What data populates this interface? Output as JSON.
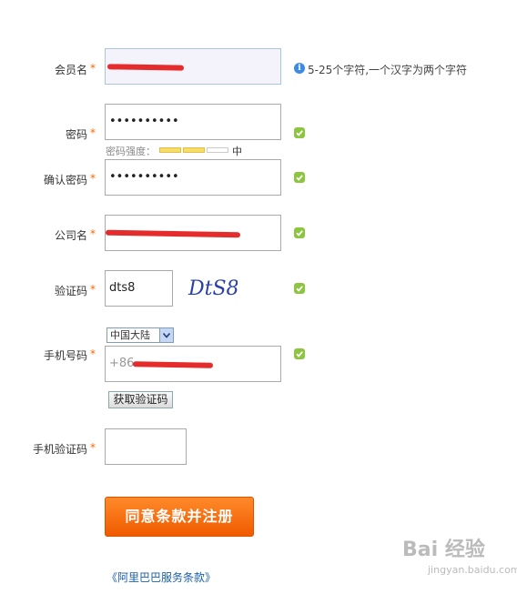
{
  "form": {
    "member_name": {
      "label": "会员名",
      "hint": "5-25个字符,一个汉字为两个字符"
    },
    "password": {
      "label": "密码",
      "value": "••••••••••",
      "strength_label": "密码强度：",
      "strength_text": "中",
      "strength_level": 2,
      "strength_max": 3
    },
    "confirm_password": {
      "label": "确认密码",
      "value": "••••••••••"
    },
    "company": {
      "label": "公司名"
    },
    "captcha": {
      "label": "验证码",
      "value": "dts8",
      "image_text": "DtS8"
    },
    "mobile": {
      "label": "手机号码",
      "region": "中国大陆",
      "prefix": "+86",
      "get_code_button": "获取验证码"
    },
    "mobile_code": {
      "label": "手机验证码",
      "value": ""
    },
    "submit_label": "同意条款并注册",
    "terms_link": "《阿里巴巴服务条款》",
    "required_mark": "*"
  },
  "watermark": {
    "logo": "Bai 经验",
    "url": "jingyan.baidu.com"
  },
  "colors": {
    "accent": "#f05a00",
    "required": "#ff6600",
    "check": "#8cc63f",
    "info": "#3b8be6",
    "redaction": "#e31a1a"
  },
  "icons": {
    "info": "info-icon",
    "check": "check-icon",
    "dropdown": "chevron-down-icon"
  }
}
